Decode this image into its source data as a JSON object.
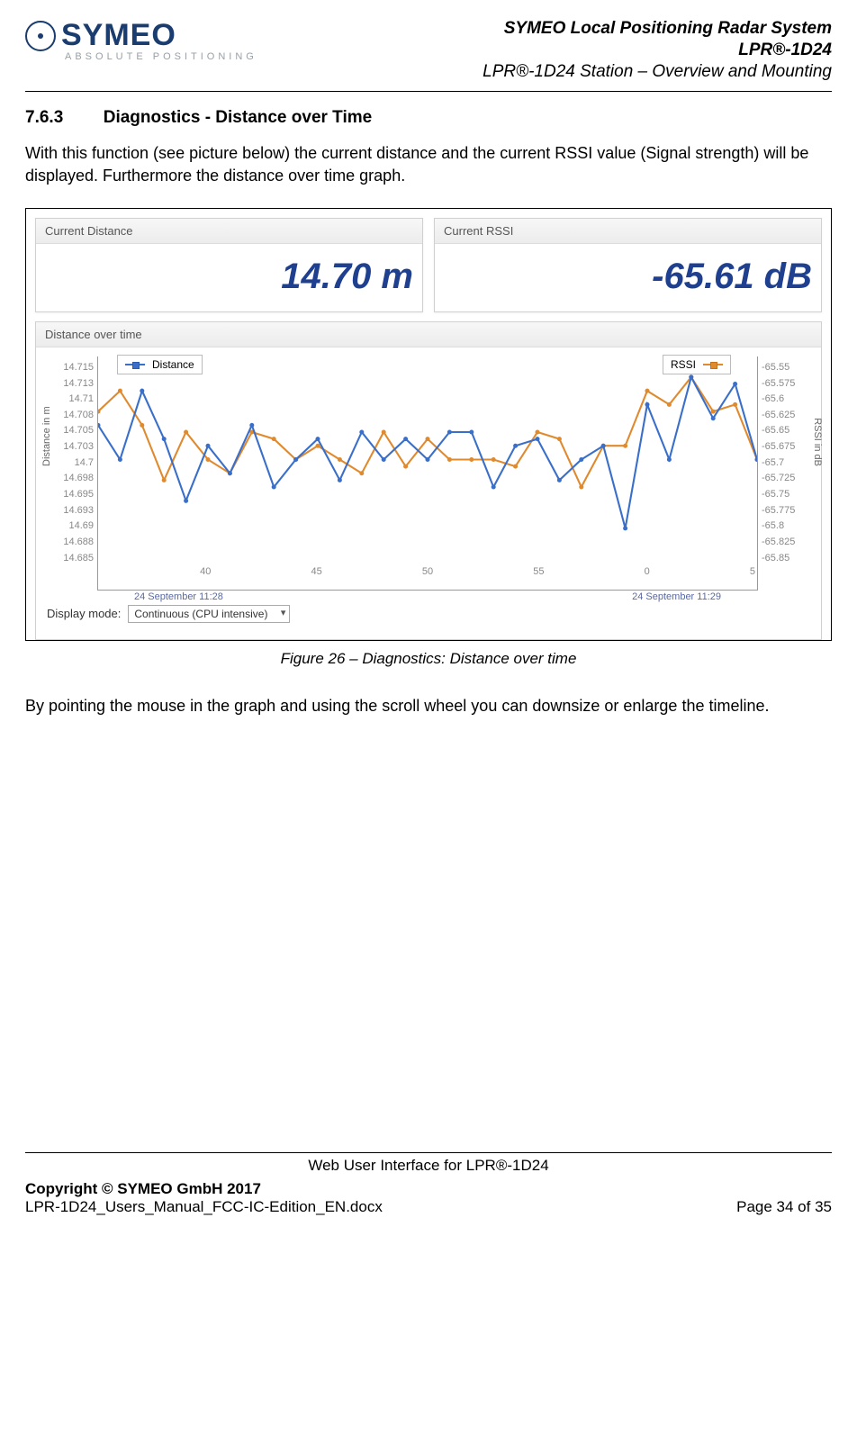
{
  "header": {
    "logo_word": "SYMEO",
    "logo_sub": "ABSOLUTE POSITIONING",
    "line1": "SYMEO Local Positioning Radar System",
    "line2": "LPR®-1D24",
    "line3": "LPR®-1D24 Station – Overview and Mounting"
  },
  "section": {
    "number": "7.6.3",
    "title": "Diagnostics - Distance over Time"
  },
  "para1": "With this function (see picture below) the current distance and the current RSSI value (Signal strength) will be displayed. Furthermore the distance over time graph.",
  "panels": {
    "left_title": "Current Distance",
    "left_value": "14.70 m",
    "right_title": "Current RSSI",
    "right_value": "-65.61 dB",
    "graph_title": "Distance over time"
  },
  "controls": {
    "display_mode_label": "Display mode:",
    "display_mode_value": "Continuous (CPU intensive)"
  },
  "caption": "Figure 26 – Diagnostics: Distance over time",
  "para2": "By pointing the mouse in the graph and using the scroll wheel you can downsize or enlarge the timeline.",
  "footer": {
    "center": "Web User Interface for LPR®-1D24",
    "left_bold": "Copyright © SYMEO GmbH 2017",
    "left_file": "LPR-1D24_Users_Manual_FCC-IC-Edition_EN.docx",
    "right": "Page 34 of 35"
  },
  "chart_data": {
    "type": "line",
    "xlabel": "",
    "title": "",
    "x_ticks": [
      "",
      "40",
      "45",
      "50",
      "55",
      "0",
      "5"
    ],
    "x_timestamps": [
      "24 September 11:28",
      "24 September 11:29"
    ],
    "left_axis": {
      "label": "Distance in m",
      "ticks": [
        "14.715",
        "14.713",
        "14.71",
        "14.708",
        "14.705",
        "14.703",
        "14.7",
        "14.698",
        "14.695",
        "14.693",
        "14.69",
        "14.688",
        "14.685"
      ],
      "range": [
        14.685,
        14.715
      ]
    },
    "right_axis": {
      "label": "RSSI in dB",
      "ticks": [
        "-65.55",
        "-65.575",
        "-65.6",
        "-65.625",
        "-65.65",
        "-65.675",
        "-65.7",
        "-65.725",
        "-65.75",
        "-65.775",
        "-65.8",
        "-65.825",
        "-65.85"
      ],
      "range": [
        -65.85,
        -65.55
      ]
    },
    "legend": {
      "left": "Distance",
      "right": "RSSI"
    },
    "colors": {
      "distance": "#3a6fc9",
      "rssi": "#e08a2e"
    },
    "x": [
      36,
      37,
      38,
      39,
      40,
      41,
      42,
      43,
      44,
      45,
      46,
      47,
      48,
      49,
      50,
      51,
      52,
      53,
      54,
      55,
      56,
      57,
      58,
      59,
      60,
      61,
      62,
      63,
      64,
      65,
      66
    ],
    "series": [
      {
        "name": "Distance",
        "axis": "left",
        "values": [
          14.705,
          14.7,
          14.71,
          14.703,
          14.694,
          14.702,
          14.698,
          14.705,
          14.696,
          14.7,
          14.703,
          14.697,
          14.704,
          14.7,
          14.703,
          14.7,
          14.704,
          14.704,
          14.696,
          14.702,
          14.703,
          14.697,
          14.7,
          14.702,
          14.69,
          14.708,
          14.7,
          14.712,
          14.706,
          14.711,
          14.7
        ]
      },
      {
        "name": "RSSI",
        "axis": "right",
        "values": [
          -65.63,
          -65.6,
          -65.65,
          -65.73,
          -65.66,
          -65.7,
          -65.72,
          -65.66,
          -65.67,
          -65.7,
          -65.68,
          -65.7,
          -65.72,
          -65.66,
          -65.71,
          -65.67,
          -65.7,
          -65.7,
          -65.7,
          -65.71,
          -65.66,
          -65.67,
          -65.74,
          -65.68,
          -65.68,
          -65.6,
          -65.62,
          -65.58,
          -65.63,
          -65.62,
          -65.7
        ]
      }
    ]
  }
}
